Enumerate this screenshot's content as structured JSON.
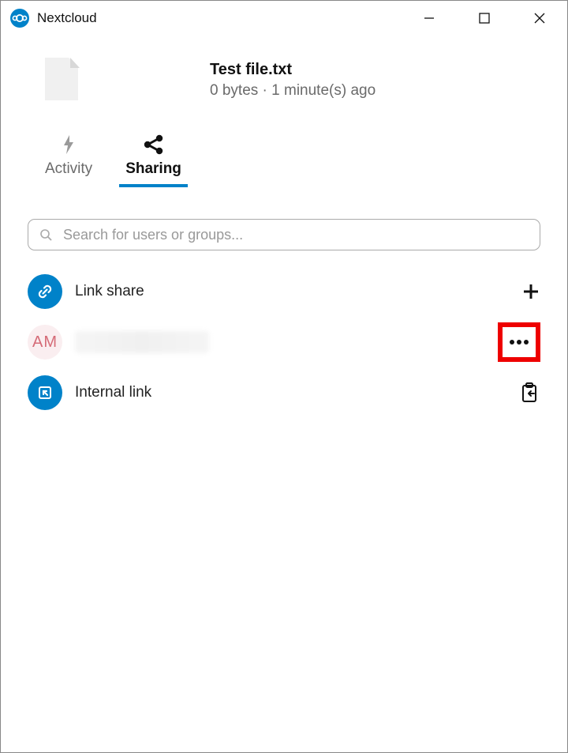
{
  "window": {
    "title": "Nextcloud"
  },
  "file": {
    "name": "Test file.txt",
    "size": "0 bytes",
    "separator": " · ",
    "ago": "1 minute(s) ago"
  },
  "tabs": {
    "activity": "Activity",
    "sharing": "Sharing"
  },
  "search": {
    "placeholder": "Search for users or groups..."
  },
  "shares": {
    "link_share": "Link share",
    "user_initials": "AM",
    "internal_link": "Internal link"
  }
}
